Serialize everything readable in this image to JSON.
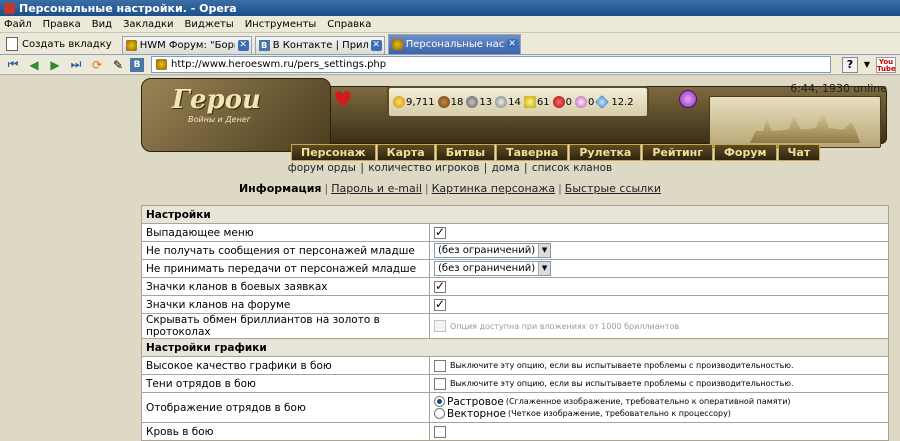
{
  "window": {
    "title": "Персональные настройки. - Opera"
  },
  "menu": [
    "Файл",
    "Правка",
    "Вид",
    "Закладки",
    "Виджеты",
    "Инструменты",
    "Справка"
  ],
  "new_tab_label": "Создать вкладку",
  "tabs": [
    {
      "label": "HWM Форум: \"Борьба с ...",
      "icon": "hwm-favicon",
      "active": false,
      "width": 130
    },
    {
      "label": "В Контакте | Приложения",
      "icon": "vk-favicon",
      "active": false,
      "width": 130
    },
    {
      "label": "Персональные настрой...",
      "icon": "hwm-favicon",
      "active": true,
      "width": 133
    }
  ],
  "address": {
    "url": "http://www.heroeswm.ru/pers_settings.php"
  },
  "game": {
    "logo": "Герои",
    "logo_sub": "Войны и Денег",
    "clock": "6:44, 1930 online",
    "resources": {
      "gold": "9,711",
      "wood": "18",
      "ore": "13",
      "mercury": "14",
      "sulfur": "61",
      "crystals": "0",
      "gems": "0",
      "diamonds": "12.2"
    },
    "nav": [
      "Персонаж",
      "Карта",
      "Битвы",
      "Таверна",
      "Рулетка",
      "Рейтинг",
      "Форум",
      "Чат"
    ],
    "sublinks": [
      "форум орды",
      "количество игроков",
      "дома",
      "список кланов"
    ]
  },
  "settings_tabs": {
    "current": "Информация",
    "links": [
      "Пароль и e-mail",
      "Картинка персонажа",
      "Быстрые ссылки"
    ]
  },
  "settings": {
    "section1": "Настройки",
    "dropdown_menu": "Выпадающее меню",
    "no_msg_junior": "Не получать сообщения от персонажей младше",
    "no_msg_value": "(без ограничений)",
    "no_transfer_junior": "Не принимать передачи от персонажей младше",
    "no_transfer_value": "(без ограничений)",
    "clan_icons_battle": "Значки кланов в боевых заявках",
    "clan_icons_forum": "Значки кланов на форуме",
    "hide_diamonds": "Скрывать обмен бриллиантов на золото в протоколах",
    "hide_diamonds_note": "Опция доступна при вложениях от 1000 бриллиантов",
    "section2": "Настройки графики",
    "hq_graphics": "Высокое качество графики в бою",
    "hq_note": "Выключите эту опцию, если вы испытываете проблемы с производительностью.",
    "unit_shadows": "Тени отрядов в бою",
    "shadows_note": "Выключите эту опцию, если вы испытываете проблемы с производительностью.",
    "unit_display": "Отображение отрядов в бою",
    "raster_label": "Растровое",
    "raster_note": "(Сглаженное изображение, требовательно к оперативной памяти)",
    "vector_label": "Векторное",
    "vector_note": "(Четкое изображение, требовательно к процессору)",
    "blood": "Кровь в бою"
  }
}
